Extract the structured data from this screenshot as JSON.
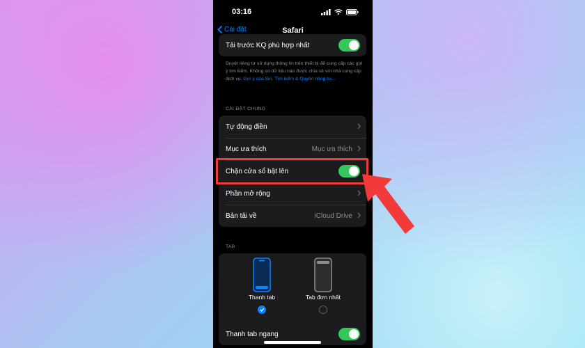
{
  "status_bar": {
    "time": "03:16"
  },
  "nav": {
    "back_label": "Cài đặt",
    "title": "Safari"
  },
  "top_row": {
    "label": "Tải trước KQ phù hợp nhất",
    "toggle_on": true
  },
  "description": {
    "text": "Duyệt riêng tư sử dụng thông tin trên thiết bị để cung cấp các gợi ý tìm kiếm. Không có dữ liệu nào được chia sẻ với nhà cung cấp dịch vụ.",
    "link": "Gợi ý của Siri, Tìm kiếm & Quyền riêng tư..."
  },
  "general": {
    "header": "CÀI ĐẶT CHUNG",
    "rows": [
      {
        "label": "Tự động điền",
        "value": ""
      },
      {
        "label": "Mục ưa thích",
        "value": "Mục ưa thích"
      },
      {
        "label": "Chặn cửa sổ bật lên",
        "toggle_on": true
      },
      {
        "label": "Phần mở rộng",
        "value": ""
      },
      {
        "label": "Bản tải về",
        "value": "iCloud Drive"
      }
    ]
  },
  "tabs": {
    "header": "TAB",
    "options": [
      {
        "label": "Thanh tab",
        "selected": true
      },
      {
        "label": "Tab đơn nhất",
        "selected": false
      }
    ],
    "landscape_row": {
      "label": "Thanh tab ngang",
      "toggle_on": true
    }
  },
  "colors": {
    "accent": "#0a84ff",
    "toggle_on": "#34c759",
    "highlight": "#f23a3a"
  }
}
